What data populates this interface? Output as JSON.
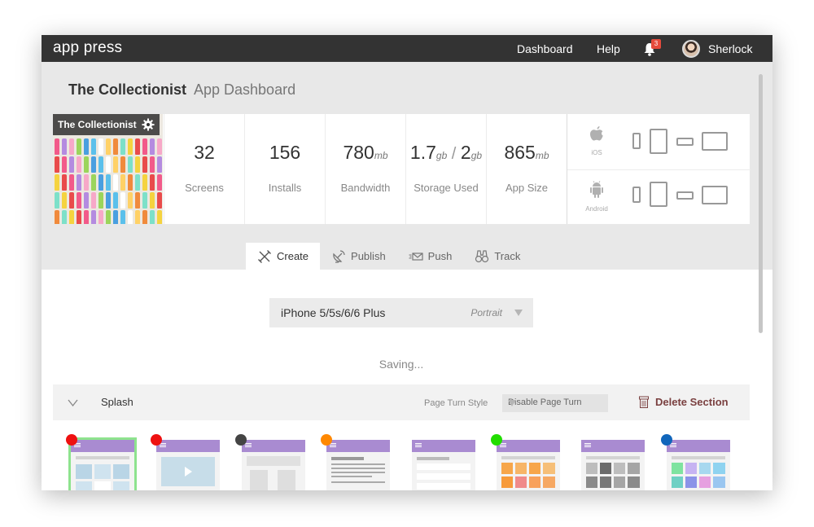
{
  "topbar": {
    "logo": "app press",
    "nav": [
      "Dashboard",
      "Help"
    ],
    "notification_count": "3",
    "username": "Sherlock"
  },
  "header": {
    "app_name": "The Collectionist",
    "subtitle": "App Dashboard"
  },
  "thumbnail": {
    "label": "The Collectionist"
  },
  "stats": [
    {
      "value": "32",
      "unit": "",
      "label": "Screens"
    },
    {
      "value": "156",
      "unit": "",
      "label": "Installs"
    },
    {
      "value": "780",
      "unit": "mb",
      "label": "Bandwidth"
    },
    {
      "value": "1.7",
      "unit": "gb",
      "value2": "2",
      "unit2": "gb",
      "separator": " / ",
      "label": "Storage Used"
    },
    {
      "value": "865",
      "unit": "mb",
      "label": "App Size"
    }
  ],
  "platforms": [
    {
      "name": "iOS",
      "icon": "apple-icon"
    },
    {
      "name": "Android",
      "icon": "android-icon"
    }
  ],
  "tabs": [
    {
      "label": "Create",
      "icon": "pencil-ruler-icon",
      "active": true
    },
    {
      "label": "Publish",
      "icon": "satellite-dish-icon",
      "active": false
    },
    {
      "label": "Push",
      "icon": "envelope-icon",
      "active": false
    },
    {
      "label": "Track",
      "icon": "binoculars-icon",
      "active": false
    }
  ],
  "device_select": {
    "device": "iPhone 5/5s/6/6 Plus",
    "orientation": "Portrait"
  },
  "status": {
    "saving": "Saving..."
  },
  "section": {
    "name": "Splash",
    "page_turn_label": "Page Turn Style",
    "page_turn_value": "Disable Page Turn",
    "delete_label": "Delete Section"
  },
  "screen_dots": [
    "#ee1111",
    "#ee1111",
    "#444444",
    "#ff8800",
    "",
    "#22dd00",
    "",
    "#1166bb"
  ],
  "colors": {
    "topbar": "#333333",
    "header_purple": "#a98bd1",
    "selected_outline": "#8ee38e",
    "delete_text": "#7a4040"
  }
}
